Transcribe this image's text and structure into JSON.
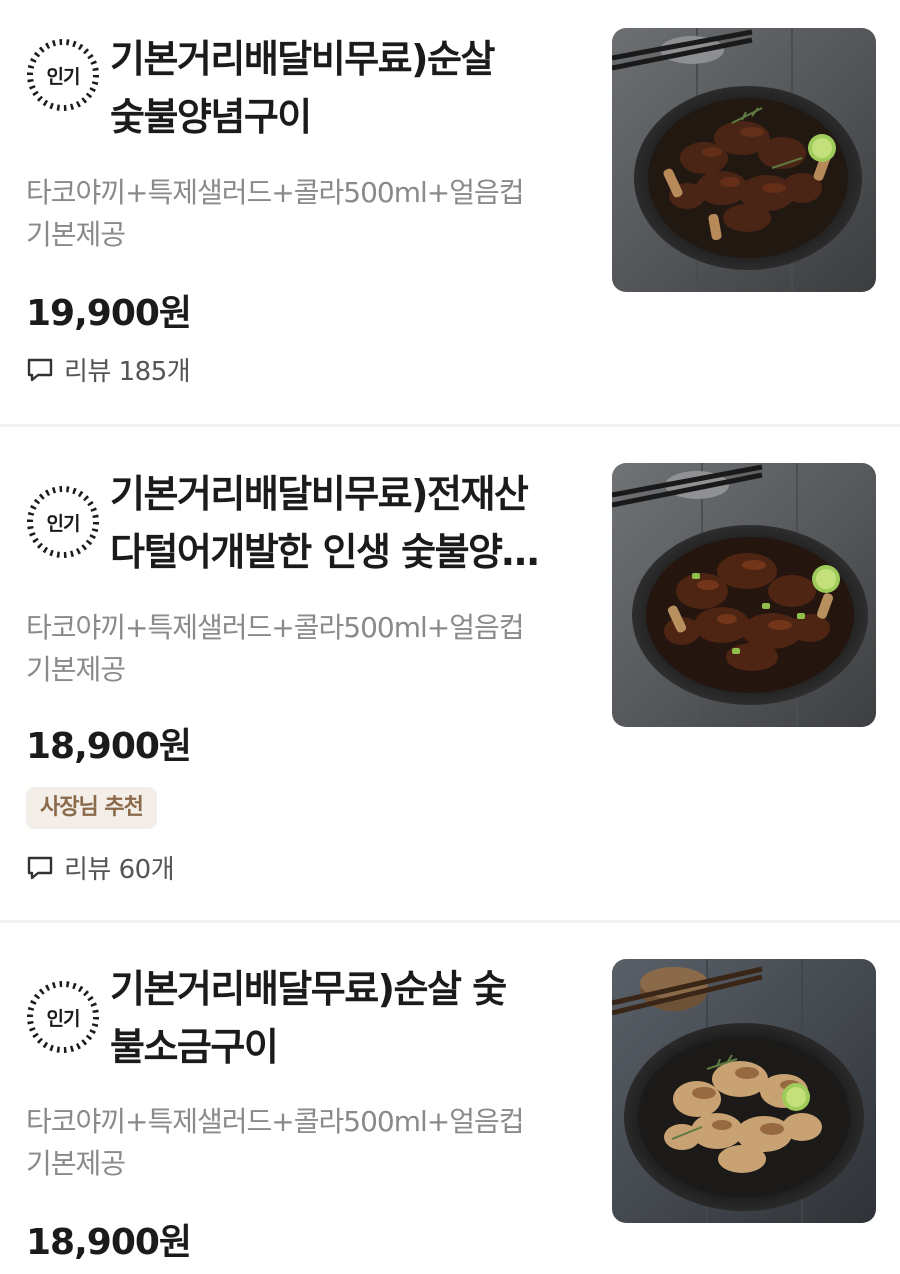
{
  "menu_items": [
    {
      "badge": "인기",
      "title_lines": [
        "기본거리배달비무료)순살",
        "숯불양념구이"
      ],
      "description_lines": [
        "타코야끼+특제샐러드+콜라500ml+얼음컵",
        "기본제공"
      ],
      "price": "19,900원",
      "tag": "",
      "reviews": "리뷰 185개",
      "photo_icon": "grilled-chicken-dish-image"
    },
    {
      "badge": "인기",
      "title_lines": [
        "기본거리배달비무료)전재산",
        "다털어개발한 인생 숯불양…"
      ],
      "description_lines": [
        "타코야끼+특제샐러드+콜라500ml+얼음컵",
        "기본제공"
      ],
      "price": "18,900원",
      "tag": "사장님 추천",
      "reviews": "리뷰 60개",
      "photo_icon": "grilled-chicken-dish-image"
    },
    {
      "badge": "인기",
      "title_lines": [
        "기본거리배달무료)순살 숯",
        "불소금구이"
      ],
      "description_lines": [
        "타코야끼+특제샐러드+콜라500ml+얼음컵",
        "기본제공"
      ],
      "price": "18,900원",
      "tag": "",
      "reviews": "",
      "photo_icon": "salt-grilled-chicken-dish-image"
    }
  ],
  "colors": {
    "text_primary": "#1b1b1b",
    "text_secondary": "#8a8a8a",
    "tag_background": "#f4eee8",
    "tag_text": "#8a6a4a",
    "divider": "#f2f2f2"
  }
}
